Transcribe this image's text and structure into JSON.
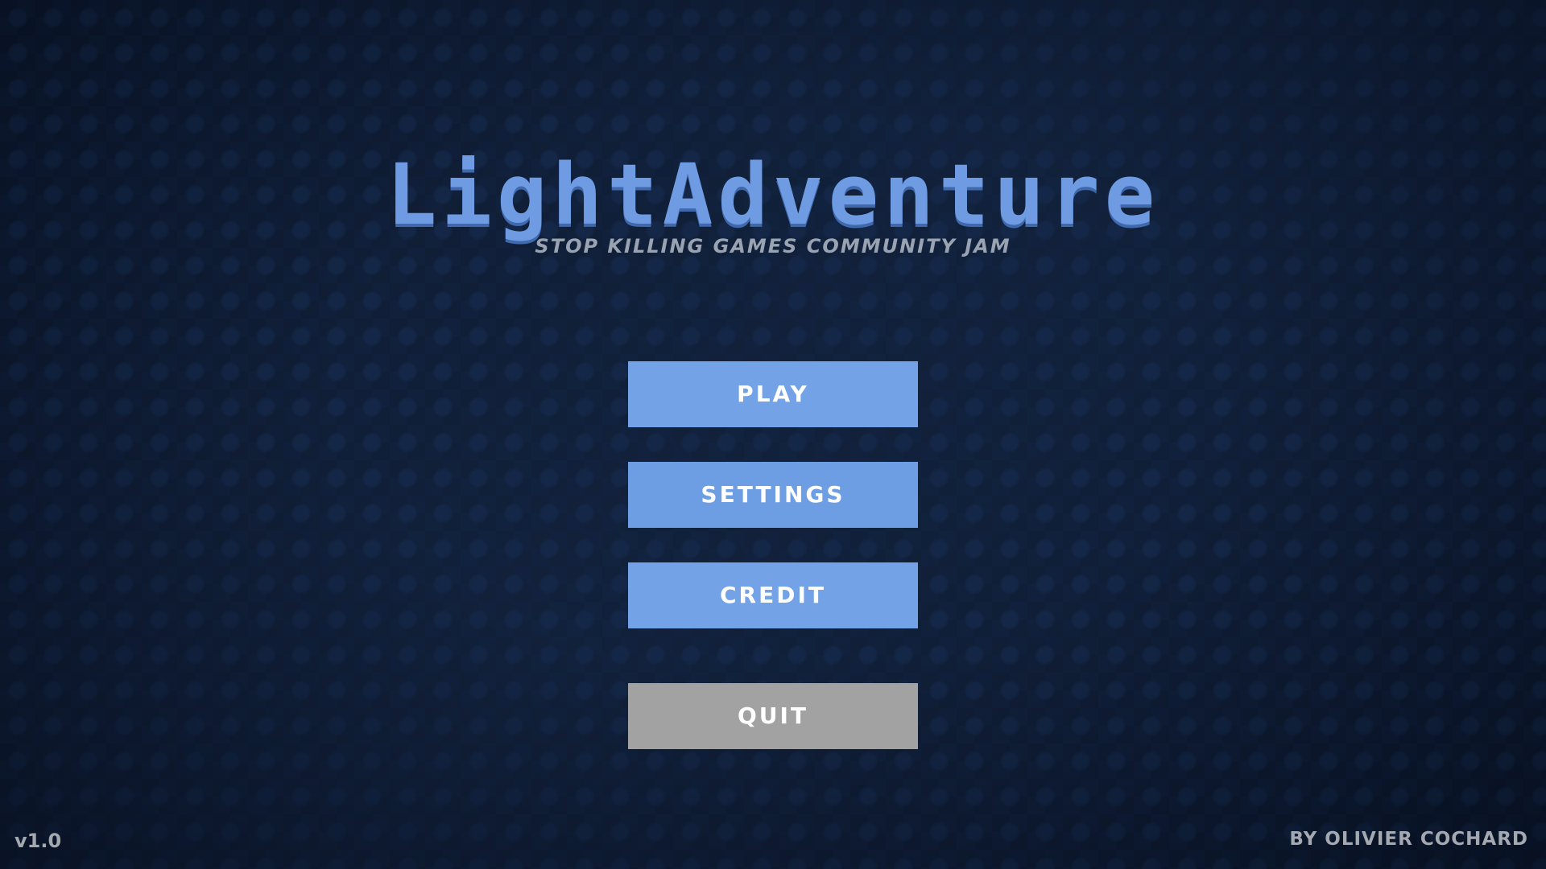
{
  "title": "LightAdventure",
  "subtitle": "Stop Killing Games Community Jam",
  "menu": {
    "play_label": "PLAY",
    "settings_label": "SETTINGS",
    "credit_label": "CREDIT",
    "quit_label": "QUIT"
  },
  "footer": {
    "version": "v1.0",
    "author": "BY OLIVIER COCHARD"
  },
  "colors": {
    "background": "#0f1d36",
    "title": "#6f9be2",
    "button_primary": "#73a3e6",
    "button_quit": "#a2a2a2",
    "footer_text": "#a4a8b0"
  }
}
